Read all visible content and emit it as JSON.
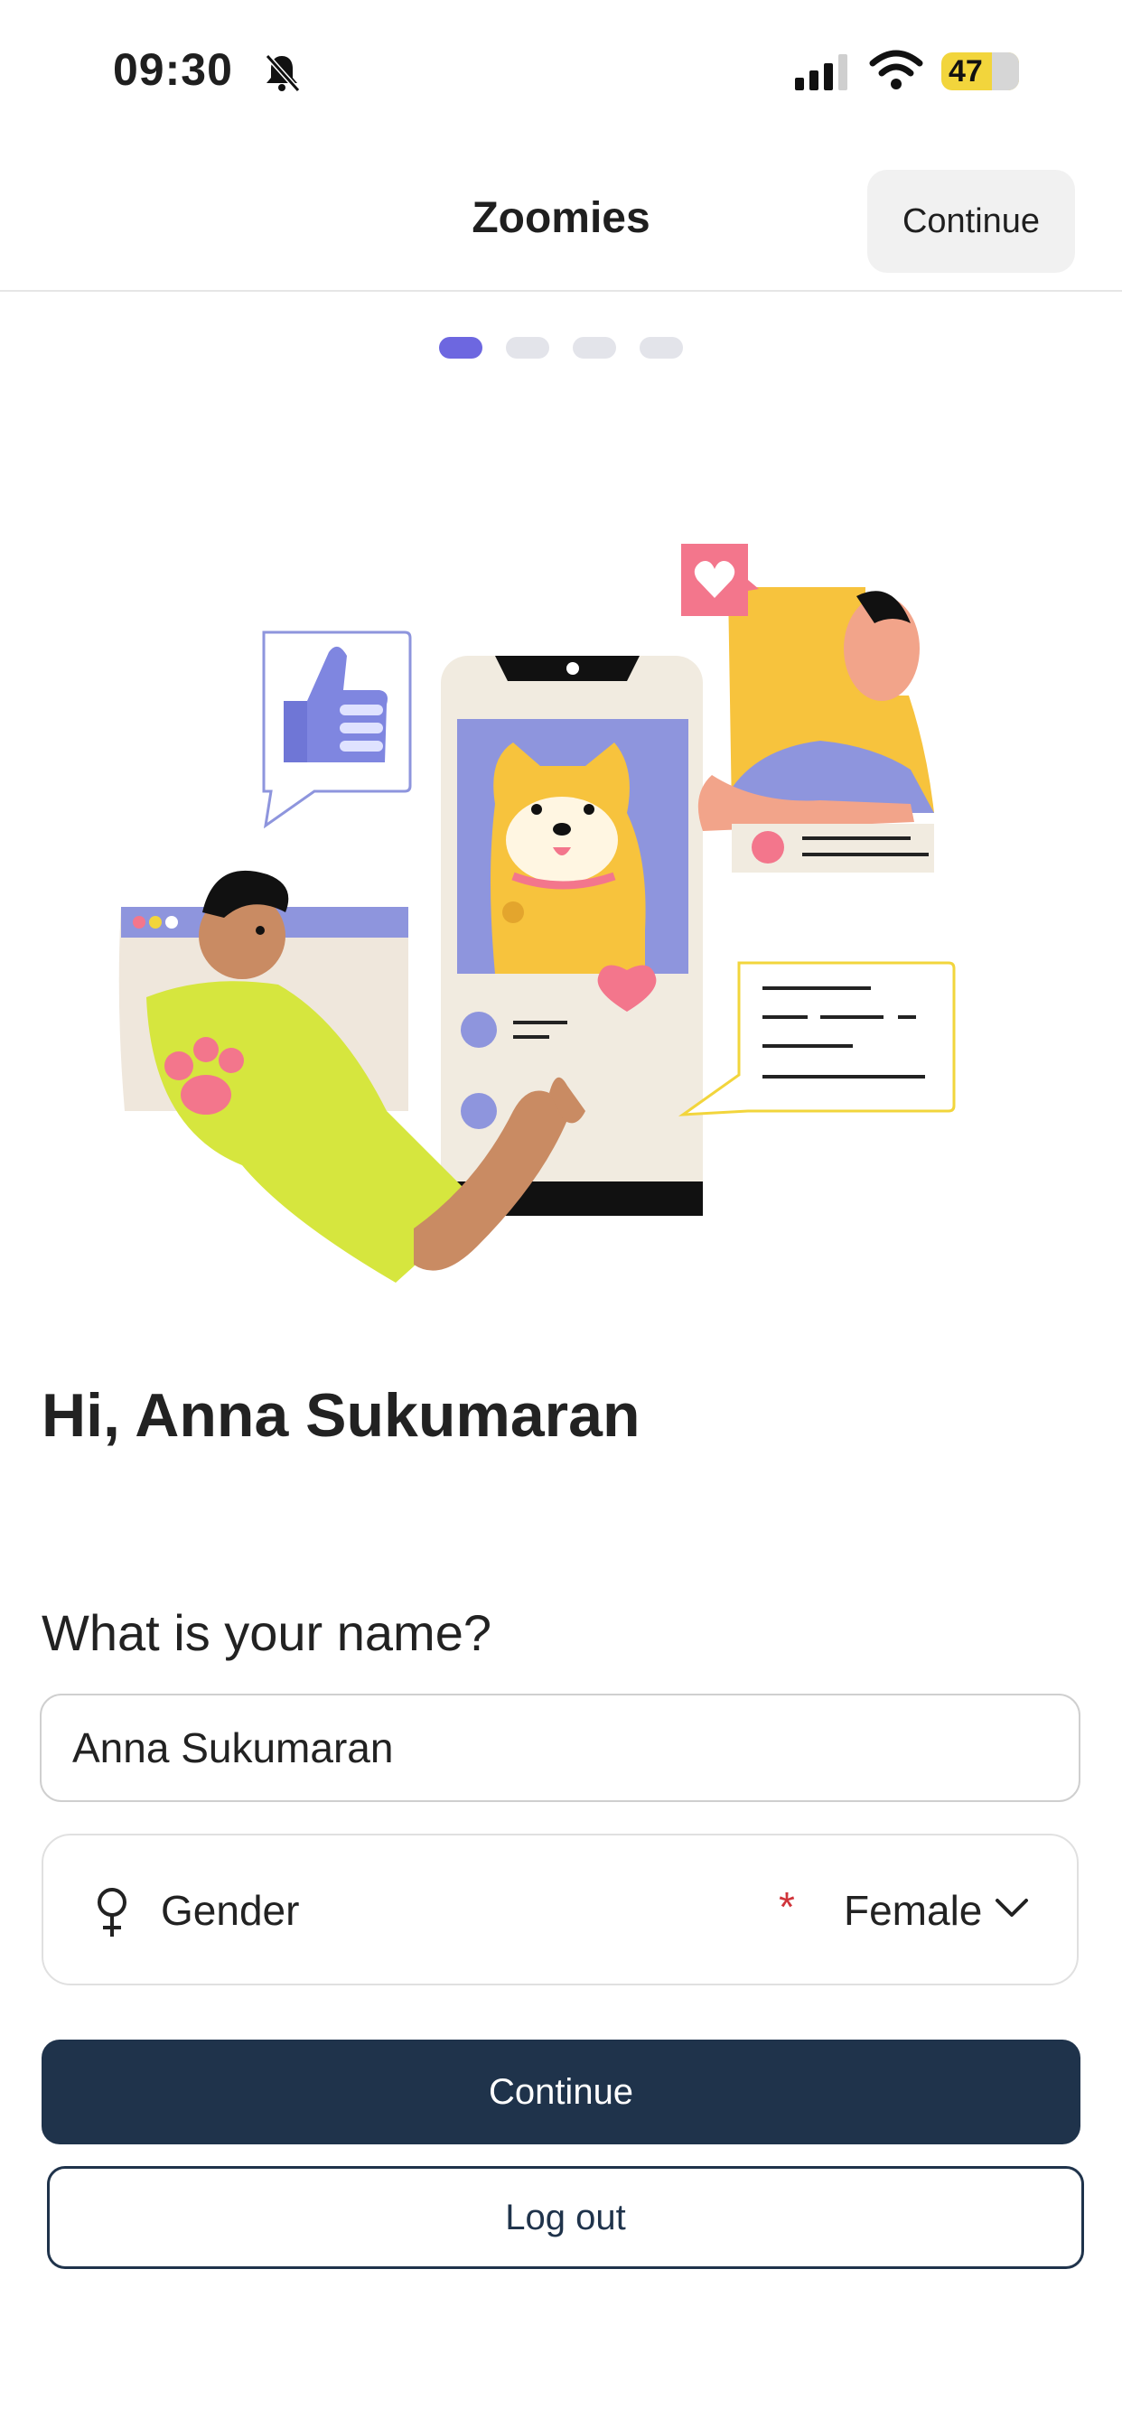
{
  "status_bar": {
    "time": "09:30",
    "battery_level": "47",
    "icons": [
      "bell-muted-icon",
      "signal-icon",
      "wifi-icon",
      "battery-charging-icon"
    ]
  },
  "header": {
    "title": "Zoomies",
    "continue_label": "Continue"
  },
  "stepper": {
    "total_steps": 4,
    "current_step": 1,
    "active_color": "#6d67e0",
    "inactive_color": "#e3e4ea"
  },
  "greeting": "Hi, Anna Sukumaran",
  "form": {
    "name_question": "What is your name?",
    "name_value": "Anna Sukumaran",
    "gender_icon": "female-symbol-icon",
    "gender_label": "Gender",
    "gender_required_mark": "*",
    "gender_value": "Female"
  },
  "actions": {
    "continue_label": "Continue",
    "logout_label": "Log out",
    "primary_color": "#1f334b"
  }
}
